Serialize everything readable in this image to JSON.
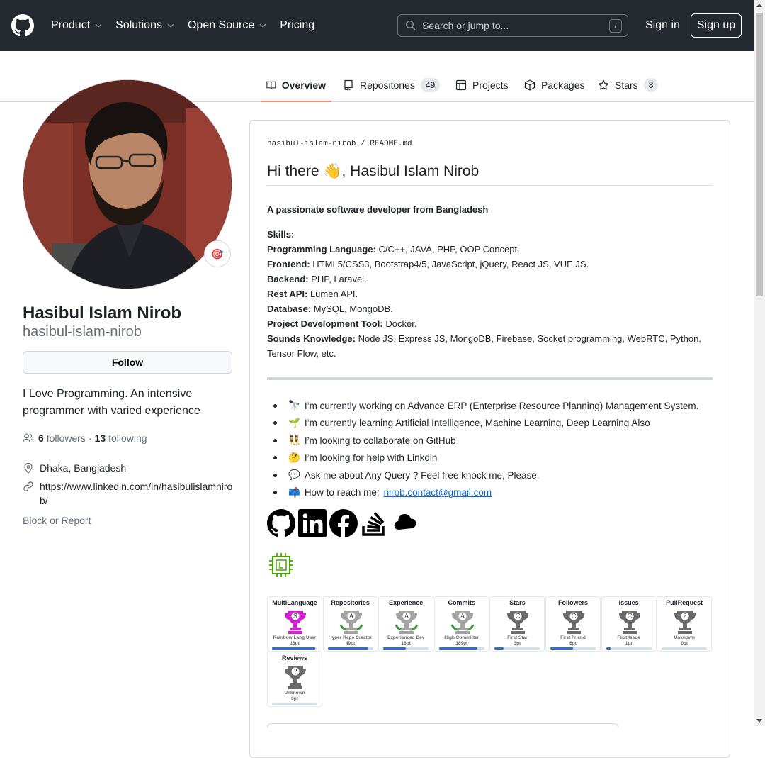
{
  "header": {
    "nav": [
      "Product",
      "Solutions",
      "Open Source",
      "Pricing"
    ],
    "search_placeholder": "Search or jump to...",
    "search_shortcut": "/",
    "sign_in": "Sign in",
    "sign_up": "Sign up"
  },
  "tabs": [
    {
      "label": "Overview",
      "icon": "book-icon"
    },
    {
      "label": "Repositories",
      "count": "49",
      "icon": "repo-icon"
    },
    {
      "label": "Projects",
      "icon": "table-icon"
    },
    {
      "label": "Packages",
      "icon": "package-icon"
    },
    {
      "label": "Stars",
      "count": "8",
      "icon": "star-icon"
    }
  ],
  "profile": {
    "full_name": "Hasibul Islam Nirob",
    "username": "hasibul-islam-nirob",
    "status_emoji": "🎯",
    "follow_label": "Follow",
    "bio": "I Love Programming. An intensive programmer with varied experience",
    "followers_count": "6",
    "followers_label": "followers",
    "following_count": "13",
    "following_label": "following",
    "separator": "·",
    "location": "Dhaka, Bangladesh",
    "website": "https://www.linkedin.com/in/hasibulislamnirob/",
    "block_report": "Block or Report"
  },
  "readme": {
    "path_user": "hasibul-islam-nirob",
    "path_sep": "/",
    "path_file": "README.md",
    "title": "Hi there 👋, Hasibul Islam Nirob",
    "tagline": "A passionate software developer from Bangladesh",
    "skills_heading": "Skills:",
    "skills": [
      {
        "label": "Programming Language:",
        "value": "C/C++, JAVA, PHP, OOP Concept."
      },
      {
        "label": "Frontend:",
        "value": "HTML5/CSS3, Bootstrap4/5, JavaScript, jQuery, React JS, VUE JS."
      },
      {
        "label": "Backend:",
        "value": "PHP, Laravel."
      },
      {
        "label": "Rest API:",
        "value": "Lumen API."
      },
      {
        "label": "Database:",
        "value": "MySQL, MongoDB."
      },
      {
        "label": "Project Development Tool:",
        "value": "Docker."
      },
      {
        "label": "Sounds Knowledge:",
        "value": "Node JS, Express JS, MongoDB, Firebase, Socket programming, WebRTC, Python, Tensor Flow, etc."
      }
    ],
    "bullets": [
      {
        "emoji": "🔭",
        "text": "I’m currently working on Advance ERP (Enterprise Resource Planning) Management System."
      },
      {
        "emoji": "🌱",
        "text": "I’m currently learning Artificial Intelligence, Machine Learning, Deep Learning Also"
      },
      {
        "emoji": "👯",
        "text": "I’m looking to collaborate on GitHub"
      },
      {
        "emoji": "🤔",
        "text": "I’m looking for help with Linkdin"
      },
      {
        "emoji": "💬",
        "text": "Ask me about Any Query ? Feel free knock me, Please."
      },
      {
        "emoji": "📫",
        "text": "How to reach me: ",
        "link": "nirob.contact@gmail.com"
      }
    ],
    "social_icons": [
      "github-icon",
      "linkedin-icon",
      "facebook-icon",
      "stackoverflow-icon",
      "cloud-icon"
    ],
    "trophies": [
      {
        "name": "MultiLanguage",
        "rank": "S",
        "title": "Rainbow Lang User",
        "points": "13pt",
        "progress": 0.95
      },
      {
        "name": "Repositories",
        "rank": "A",
        "title": "Hyper Repo Creator",
        "points": "49pt",
        "progress": 0.9
      },
      {
        "name": "Experience",
        "rank": "A",
        "title": "Experienced Dev",
        "points": "18pt",
        "progress": 0.5
      },
      {
        "name": "Commits",
        "rank": "A",
        "title": "High Committer",
        "points": "189pt",
        "progress": 0.85
      },
      {
        "name": "Stars",
        "rank": "C",
        "title": "First Star",
        "points": "3pt",
        "progress": 0.2
      },
      {
        "name": "Followers",
        "rank": "C",
        "title": "First Friend",
        "points": "6pt",
        "progress": 0.5
      },
      {
        "name": "Issues",
        "rank": "C",
        "title": "First Issue",
        "points": "1pt",
        "progress": 0.1
      },
      {
        "name": "PullRequest",
        "rank": "?",
        "title": "Unknown",
        "points": "0pt",
        "progress": 0
      },
      {
        "name": "Reviews",
        "rank": "?",
        "title": "Unknown",
        "points": "0pt",
        "progress": 0
      }
    ]
  },
  "colors": {
    "header_bg": "#24292f",
    "tab_underline": "#fd8c73",
    "link": "#0969da",
    "trophy_bronze": "#6b6b6b",
    "trophy_gold": "#a5a5a5",
    "trophy_rainbow": "#d21fd0"
  }
}
